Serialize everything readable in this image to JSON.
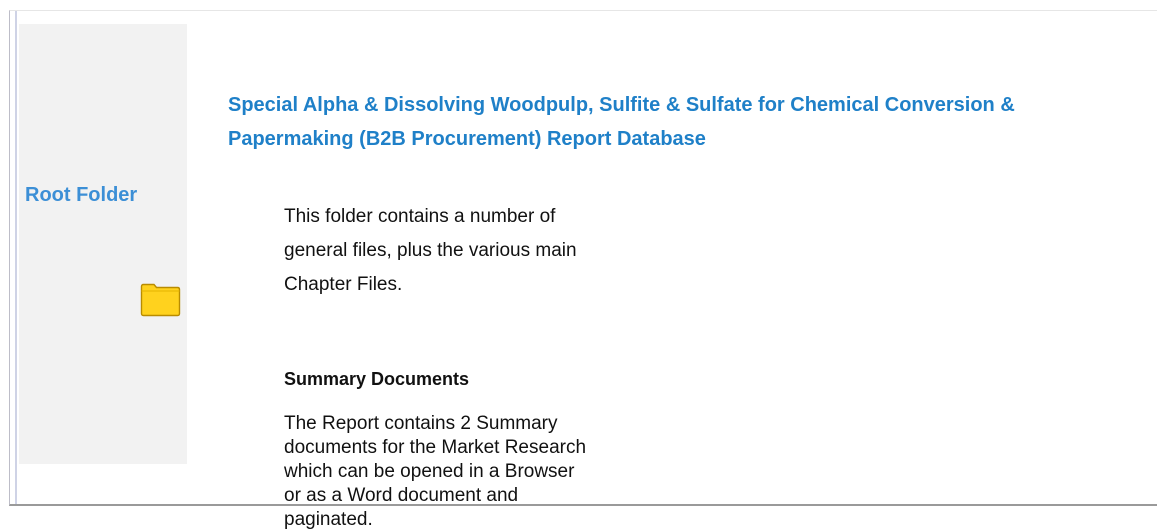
{
  "sidebar": {
    "title": "Root Folder",
    "icon": "folder-icon",
    "folder_color": "#ffd21e"
  },
  "main": {
    "title": "Special Alpha & Dissolving Woodpulp, Sulfite & Sulfate for Chemical Conversion & Papermaking (B2B Procurement) Report Database",
    "intro": "This folder contains a number of general files, plus the various main Chapter Files.",
    "section": {
      "heading": "Summary Documents",
      "body": "The Report contains 2 Summary documents for the Market Research which can be opened in a Browser or as a Word document and paginated."
    }
  },
  "colors": {
    "title": "#1f80c8",
    "sidebar_title": "#3c8fd6",
    "sidebar_bg": "#f2f2f2"
  }
}
